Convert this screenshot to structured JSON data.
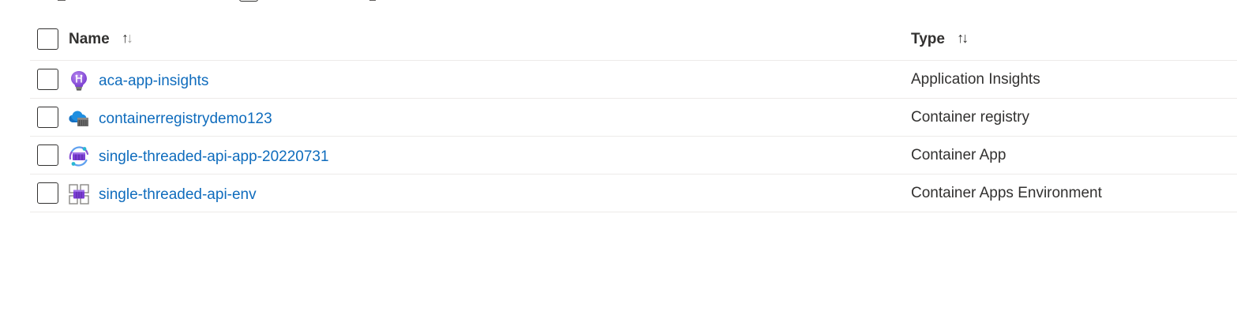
{
  "table": {
    "columns": {
      "name": {
        "label": "Name"
      },
      "type": {
        "label": "Type"
      }
    },
    "rows": [
      {
        "name": "aca-app-insights",
        "type": "Application Insights",
        "icon": "application-insights-icon"
      },
      {
        "name": "containerregistrydemo123",
        "type": "Container registry",
        "icon": "container-registry-icon"
      },
      {
        "name": "single-threaded-api-app-20220731",
        "type": "Container App",
        "icon": "container-app-icon"
      },
      {
        "name": "single-threaded-api-env",
        "type": "Container Apps Environment",
        "icon": "container-apps-environment-icon"
      }
    ]
  },
  "colors": {
    "link": "#0f6cbd",
    "text": "#323130",
    "divider": "#edebe9",
    "purple": "#8a55d4",
    "azure_blue": "#1e8ee0"
  }
}
